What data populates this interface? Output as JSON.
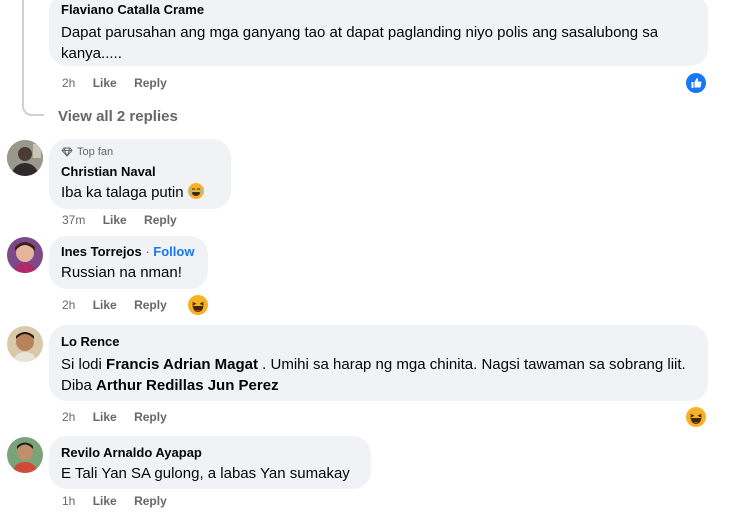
{
  "comments": [
    {
      "author": "Flaviano Catalla Crame",
      "text": "Dapat parusahan ang mga ganyang tao at dapat paglanding niyo polis ang sasalubong sa kanya.....",
      "time": "2h",
      "like": "Like",
      "reply": "Reply",
      "reaction": "like"
    },
    {
      "badge": "Top fan",
      "author": "Christian Naval",
      "text": "Iba ka talaga putin",
      "time": "37m",
      "like": "Like",
      "reply": "Reply"
    },
    {
      "author": "Ines Torrejos",
      "separator": "·",
      "follow": "Follow",
      "text": "Russian na nman!",
      "time": "2h",
      "like": "Like",
      "reply": "Reply",
      "reaction": "haha"
    },
    {
      "author": "Lo Rence",
      "text_parts": [
        "Si lodi ",
        "Francis Adrian Magat",
        " . Umihi sa harap ng mga chinita. Nagsi tawaman sa sobrang liit. Diba ",
        "Arthur Redillas Jun Perez"
      ],
      "time": "2h",
      "like": "Like",
      "reply": "Reply",
      "reaction": "haha"
    },
    {
      "author": "Revilo Arnaldo Ayapap",
      "text": "E Tali Yan SA gulong, a labas Yan sumakay",
      "time": "1h",
      "like": "Like",
      "reply": "Reply"
    }
  ],
  "view_replies": "View all 2 replies",
  "colors": {
    "bubble": "#f0f2f5",
    "meta": "#65676b",
    "link": "#1877f2",
    "like_blue": "#1877f2",
    "haha_yellow": "#f7b125"
  }
}
